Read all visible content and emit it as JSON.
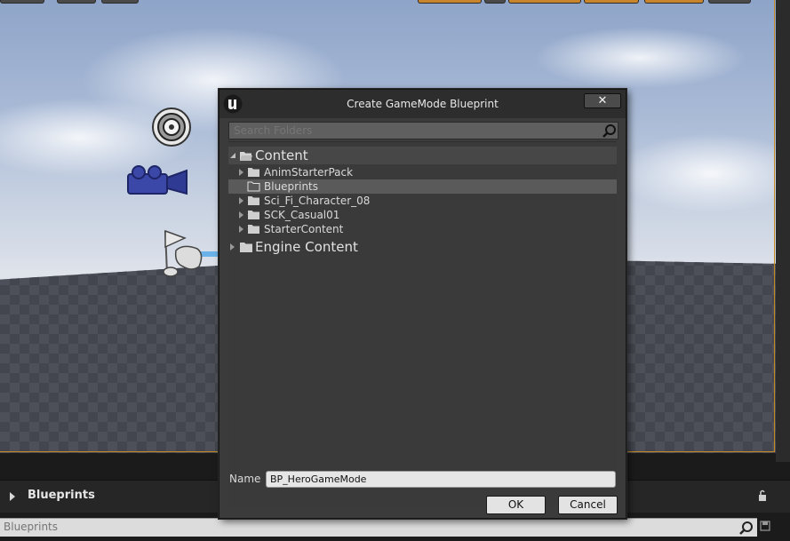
{
  "dialog": {
    "title": "Create GameMode Blueprint",
    "close_label": "✕",
    "search_placeholder": "Search Folders",
    "tree": {
      "root": {
        "label": "Content"
      },
      "children": [
        {
          "label": "AnimStarterPack",
          "expandable": true
        },
        {
          "label": "Blueprints",
          "expandable": false,
          "selected": true
        },
        {
          "label": "Sci_Fi_Character_08",
          "expandable": true
        },
        {
          "label": "SCK_Casual01",
          "expandable": true
        },
        {
          "label": "StarterContent",
          "expandable": true
        }
      ],
      "engine": {
        "label": "Engine Content"
      }
    },
    "name_label": "Name",
    "name_value": "BP_HeroGameMode",
    "ok_label": "OK",
    "cancel_label": "Cancel"
  },
  "bottom_panel": {
    "title": "Blueprints",
    "search_placeholder": "Blueprints"
  },
  "colors": {
    "accent": "#c9852b",
    "dialog_bg": "#3b3b3b",
    "selection": "#5a5a5a"
  },
  "icons": [
    "ue-logo-icon",
    "close-icon",
    "search-icon",
    "folder-icon",
    "lock-icon",
    "save-icon",
    "sphere-reflection-icon",
    "camera-icon",
    "player-start-icon"
  ]
}
